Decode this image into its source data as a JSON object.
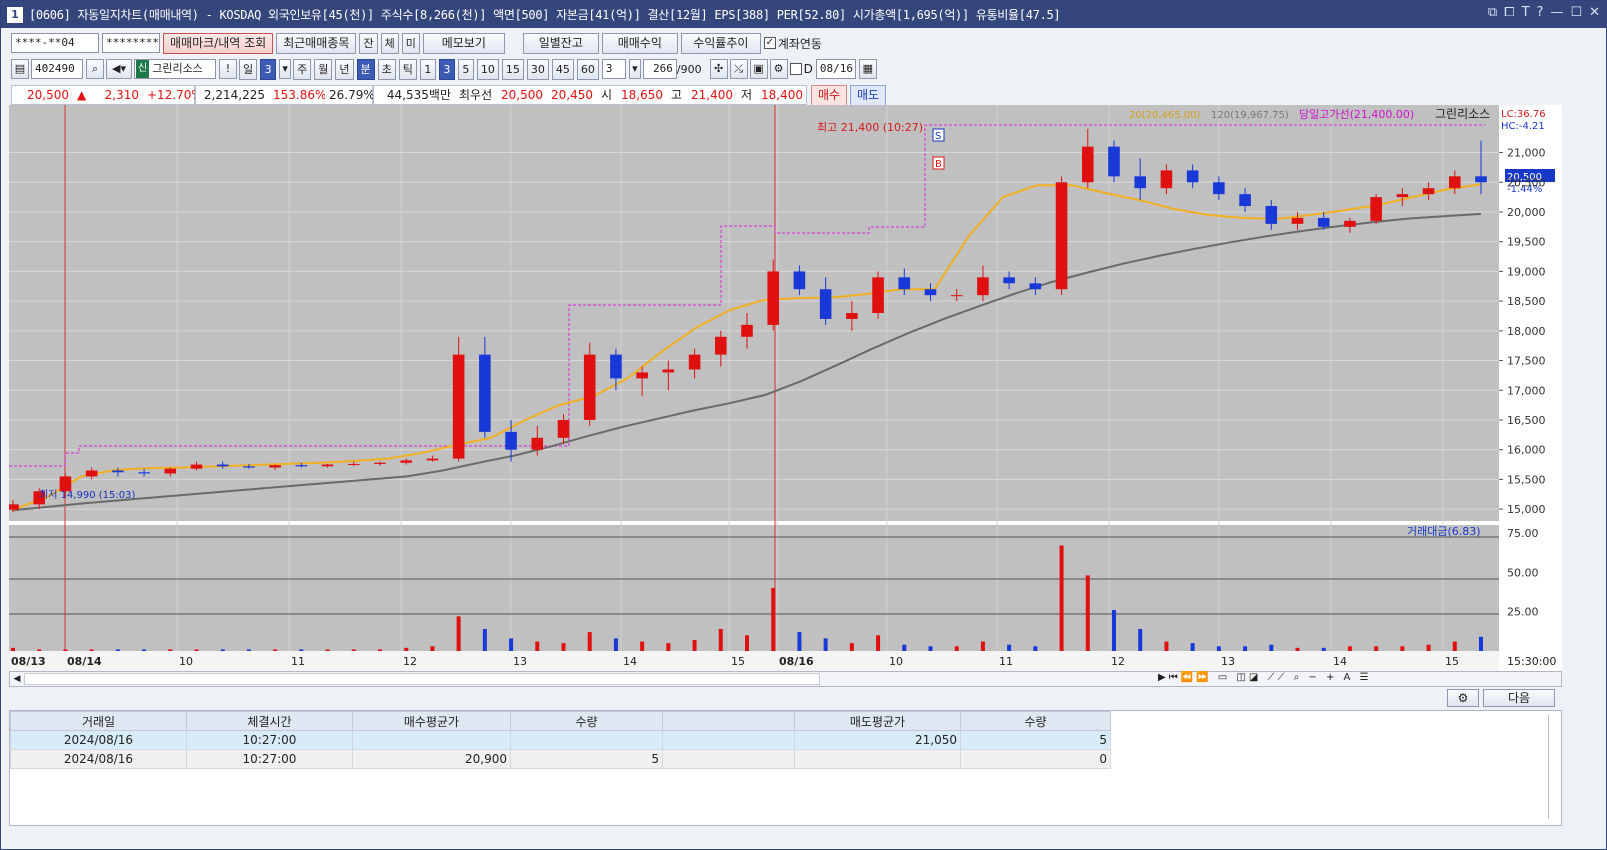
{
  "window": {
    "title": "[0606] 자동일지차트(매매내역) - KOSDAQ 외국인보유[45(천)] 주식수[8,266(천)] 액면[500] 자본금[41(억)] 결산[12월] EPS[388] PER[52.80] 시가총액[1,695(억)] 유통비율[47.5]",
    "badge": "1",
    "controls": [
      "⧉",
      "⧠",
      "T",
      "?",
      "—",
      "☐",
      "✕"
    ]
  },
  "toolbar1": {
    "account": "****-**04",
    "password": "********",
    "btn_mark": "매매마크/내역 조회",
    "btn_recent": "최근매매종목",
    "btn_jan": "잔",
    "btn_che": "체",
    "btn_mi": "미",
    "btn_memo": "메모보기",
    "btn_daily": "일별잔고",
    "btn_profit": "매매수익",
    "btn_trend": "수익률추이",
    "link_label": "계좌연동",
    "link_checked": true
  },
  "toolbar2": {
    "code": "402490",
    "market_badge": "신",
    "stock_name": "그린리소스",
    "periods": [
      "일",
      "3",
      "주",
      "월",
      "년",
      "분",
      "초",
      "틱"
    ],
    "selected_period": "3",
    "minutes": [
      "1",
      "3",
      "5",
      "10",
      "15",
      "30",
      "45",
      "60"
    ],
    "selected_minute": "3",
    "count_value": "3",
    "bars": "266",
    "bars_total": "/900",
    "d_label": "D",
    "date": "08/16"
  },
  "quote": {
    "price": "20,500",
    "arrow": "▲",
    "change": "2,310",
    "change_pct": "+12.70%",
    "volume": "2,214,225",
    "vol_ratio": "153.86%",
    "turnover": "26.79%",
    "amount": "44,535백만",
    "best_label": "최우선",
    "ask": "20,500",
    "bid": "20,450",
    "open_label": "시",
    "open": "18,650",
    "high_label": "고",
    "high": "21,400",
    "low_label": "저",
    "low": "18,400",
    "buy_btn": "매수",
    "sell_btn": "매도"
  },
  "chart_data": {
    "type": "candlestick",
    "price_axis": [
      "21,000",
      "20,500",
      "20,000",
      "19,500",
      "19,000",
      "18,500",
      "18,000",
      "17,500",
      "17,000",
      "16,500",
      "16,000",
      "15,500",
      "15,000"
    ],
    "price_range": [
      14800,
      21800
    ],
    "legend": {
      "ma20": "20(20,465.00)",
      "ma120": "120(19,967.75)",
      "high_line": "당일고가선(21,400.00)",
      "stock": "그린리소스"
    },
    "lc": "LC:36.76",
    "hc": "HC:-4.21",
    "current_price": "20,500",
    "current_pct": "-1.44%",
    "high_annotation": "최고 21,400 (10:27)",
    "low_annotation": "최저 14,990 (15:03)",
    "buy_marker": "B",
    "sell_marker": "S",
    "volume_title": "거래대금(6.83)",
    "volume_axis": [
      "75.00",
      "50.00",
      "25.00"
    ],
    "volume_range": [
      0,
      80
    ],
    "x_labels": [
      "08/13",
      "08/14",
      "10",
      "11",
      "12",
      "13",
      "14",
      "15",
      "08/16",
      "10",
      "11",
      "12",
      "13",
      "14",
      "15"
    ],
    "time_end": "15:30:00",
    "ma20": [
      14990,
      15200,
      15550,
      15660,
      15690,
      15700,
      15720,
      15740,
      15760,
      15780,
      15810,
      15850,
      15950,
      16080,
      16200,
      16500,
      16750,
      16900,
      17200,
      17650,
      18050,
      18350,
      18520,
      18550,
      18560,
      18620,
      18700,
      18700,
      19600,
      20250,
      20450,
      20450,
      20320,
      20200,
      20050,
      19950,
      19900,
      19880,
      19950,
      20030,
      20120,
      20250,
      20380,
      20465
    ],
    "ma120": [
      14980,
      15040,
      15100,
      15150,
      15200,
      15250,
      15300,
      15350,
      15400,
      15450,
      15500,
      15550,
      15650,
      15780,
      15900,
      16050,
      16220,
      16380,
      16520,
      16660,
      16780,
      16920,
      17150,
      17420,
      17700,
      17960,
      18200,
      18420,
      18630,
      18820,
      18980,
      19130,
      19260,
      19380,
      19490,
      19590,
      19680,
      19760,
      19830,
      19890,
      19930,
      19967
    ],
    "candles": [
      [
        14990,
        15150,
        14950,
        15080
      ],
      [
        15080,
        15350,
        15000,
        15300
      ],
      [
        15300,
        15600,
        15200,
        15550
      ],
      [
        15550,
        15700,
        15500,
        15650
      ],
      [
        15650,
        15700,
        15550,
        15620
      ],
      [
        15620,
        15680,
        15550,
        15600
      ],
      [
        15600,
        15700,
        15550,
        15680
      ],
      [
        15680,
        15800,
        15650,
        15750
      ],
      [
        15750,
        15800,
        15680,
        15720
      ],
      [
        15720,
        15760,
        15680,
        15700
      ],
      [
        15700,
        15750,
        15660,
        15740
      ],
      [
        15740,
        15780,
        15700,
        15720
      ],
      [
        15720,
        15760,
        15700,
        15750
      ],
      [
        15750,
        15800,
        15720,
        15760
      ],
      [
        15760,
        15800,
        15730,
        15780
      ],
      [
        15780,
        15850,
        15750,
        15820
      ],
      [
        15820,
        15900,
        15800,
        15850
      ],
      [
        15850,
        17900,
        15800,
        17600
      ],
      [
        17600,
        17900,
        16200,
        16300
      ],
      [
        16300,
        16500,
        15800,
        16000
      ],
      [
        16000,
        16400,
        15900,
        16200
      ],
      [
        16200,
        16600,
        16100,
        16500
      ],
      [
        16500,
        17800,
        16400,
        17600
      ],
      [
        17600,
        17700,
        17000,
        17200
      ],
      [
        17200,
        17400,
        16900,
        17300
      ],
      [
        17300,
        17500,
        17000,
        17350
      ],
      [
        17350,
        17700,
        17200,
        17600
      ],
      [
        17600,
        18000,
        17400,
        17900
      ],
      [
        17900,
        18300,
        17700,
        18100
      ],
      [
        18100,
        19200,
        18000,
        19000
      ],
      [
        19000,
        19100,
        18600,
        18700
      ],
      [
        18700,
        18900,
        18100,
        18200
      ],
      [
        18200,
        18500,
        18000,
        18300
      ],
      [
        18300,
        19000,
        18200,
        18900
      ],
      [
        18900,
        19050,
        18600,
        18700
      ],
      [
        18700,
        18800,
        18500,
        18600
      ],
      [
        18600,
        18700,
        18500,
        18600
      ],
      [
        18600,
        19100,
        18500,
        18900
      ],
      [
        18900,
        19000,
        18700,
        18800
      ],
      [
        18800,
        18900,
        18600,
        18700
      ],
      [
        18700,
        20600,
        18600,
        20500
      ],
      [
        20500,
        21400,
        20400,
        21100
      ],
      [
        21100,
        21200,
        20500,
        20600
      ],
      [
        20600,
        20900,
        20200,
        20400
      ],
      [
        20400,
        20800,
        20300,
        20700
      ],
      [
        20700,
        20800,
        20400,
        20500
      ],
      [
        20500,
        20600,
        20200,
        20300
      ],
      [
        20300,
        20400,
        20000,
        20100
      ],
      [
        20100,
        20200,
        19700,
        19800
      ],
      [
        19800,
        20000,
        19700,
        19900
      ],
      [
        19900,
        20000,
        19700,
        19750
      ],
      [
        19750,
        19900,
        19650,
        19850
      ],
      [
        19850,
        20300,
        19800,
        20250
      ],
      [
        20250,
        20400,
        20100,
        20300
      ],
      [
        20300,
        20500,
        20200,
        20400
      ],
      [
        20400,
        20700,
        20300,
        20600
      ],
      [
        20600,
        21200,
        20300,
        20500
      ]
    ],
    "volume": [
      2,
      1,
      1,
      1,
      1,
      1,
      1,
      1,
      1,
      1,
      1,
      1,
      1,
      1,
      1,
      2,
      3,
      22,
      14,
      8,
      6,
      5,
      12,
      8,
      6,
      5,
      7,
      14,
      10,
      40,
      12,
      8,
      5,
      10,
      4,
      3,
      3,
      6,
      4,
      3,
      67,
      48,
      26,
      14,
      6,
      5,
      3,
      3,
      4,
      2,
      2,
      3,
      3,
      3,
      4,
      6,
      9
    ]
  },
  "grid": {
    "headers": [
      "거래일",
      "체결시간",
      "매수평균가",
      "수량",
      "",
      "매도평균가",
      "수량"
    ],
    "rows": [
      [
        "2024/08/16",
        "10:27:00",
        "",
        "",
        "",
        "21,050",
        "5"
      ],
      [
        "2024/08/16",
        "10:27:00",
        "20,900",
        "5",
        "",
        "",
        "0"
      ]
    ],
    "next_btn": "다음"
  }
}
